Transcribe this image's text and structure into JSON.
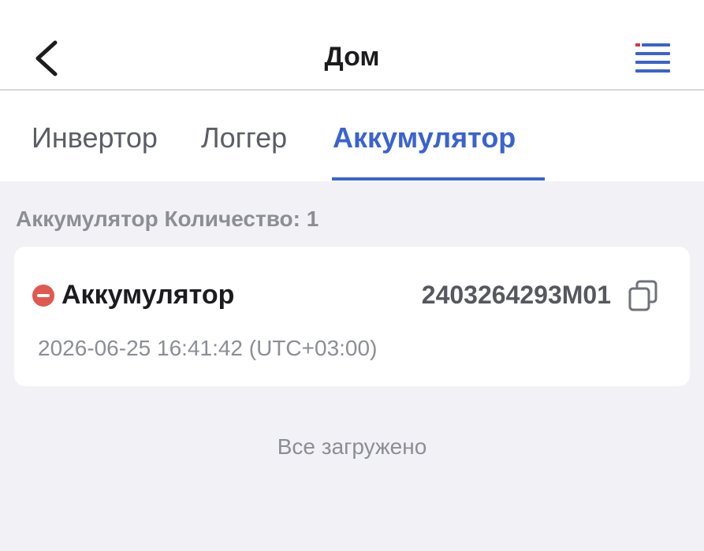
{
  "header": {
    "title": "Дом",
    "back_icon": "chevron-left-icon",
    "menu_icon": "menu-list-icon"
  },
  "tabs": [
    {
      "label": "Инвертор",
      "active": false
    },
    {
      "label": "Логгер",
      "active": false
    },
    {
      "label": "Аккумулятор",
      "active": true
    }
  ],
  "list": {
    "count_label": "Аккумулятор Количество: 1",
    "items": [
      {
        "name": "Аккумулятор",
        "status": "offline",
        "status_icon": "minus-circle-icon",
        "serial": "2403264293M01",
        "copy_icon": "copy-icon",
        "timestamp": "2026-06-25 16:41:42 (UTC+03:00)"
      }
    ],
    "footer": "Все загружено"
  },
  "colors": {
    "accent": "#3a63d0",
    "status_offline": "#e0584f",
    "background": "#f2f2f6",
    "menu_flag_red": "#d9363e"
  }
}
